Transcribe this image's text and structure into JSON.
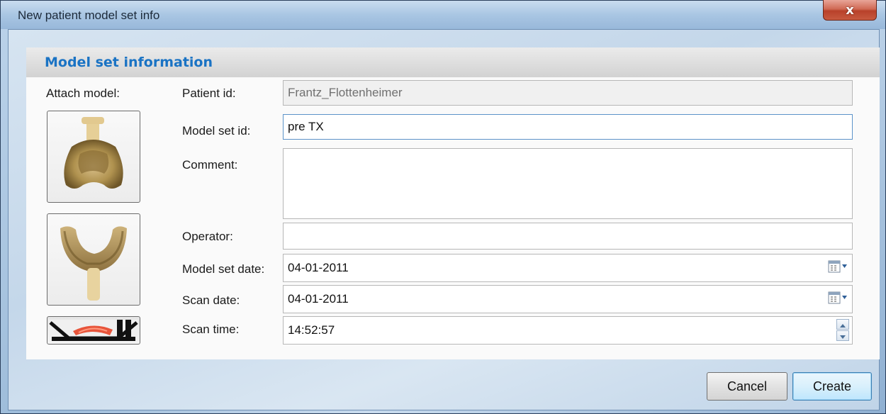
{
  "window": {
    "title": "New patient model set info",
    "close_symbol": "x"
  },
  "section": {
    "title": "Model set information"
  },
  "attach": {
    "label": "Attach model:"
  },
  "form": {
    "patient_id": {
      "label": "Patient id:",
      "value": "Frantz_Flottenheimer"
    },
    "model_set_id": {
      "label": "Model set id:",
      "value": "pre TX"
    },
    "comment": {
      "label": "Comment:",
      "value": ""
    },
    "operator": {
      "label": "Operator:",
      "value": ""
    },
    "model_set_date": {
      "label": "Model set date:",
      "value": "04-01-2011"
    },
    "scan_date": {
      "label": "Scan date:",
      "value": "04-01-2011"
    },
    "scan_time": {
      "label": "Scan time:",
      "value": "14:52:57"
    }
  },
  "buttons": {
    "cancel": "Cancel",
    "create": "Create"
  },
  "icons": {
    "upper_model": "upper-jaw-model-icon",
    "lower_model": "lower-jaw-model-icon",
    "bite": "bite-scan-icon",
    "calendar": "calendar-dropdown-icon",
    "spinner": "time-spinner-icon"
  },
  "colors": {
    "accent": "#1a73c4",
    "close": "#c75a40",
    "model": "#b99b58"
  }
}
